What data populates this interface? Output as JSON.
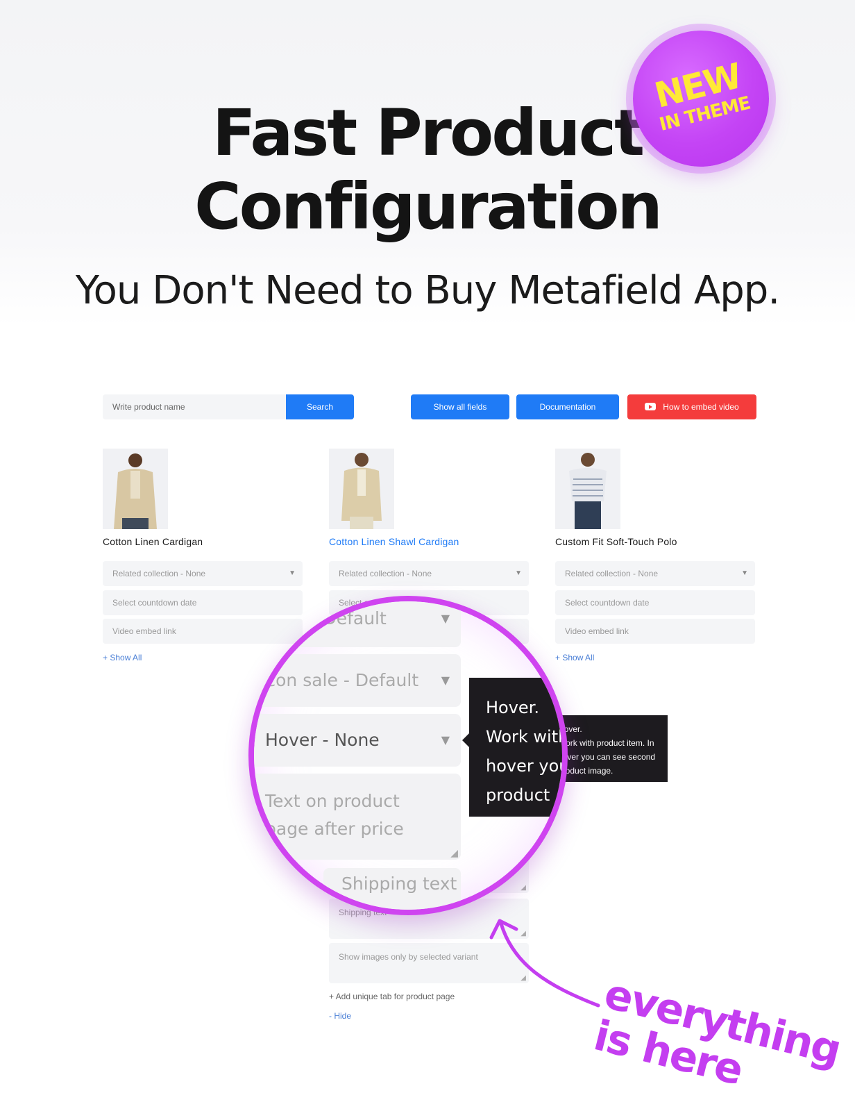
{
  "hero": {
    "title_line1": "Fast Product",
    "title_line2": "Configuration",
    "subtitle": "You Don't Need to Buy Metafield App.",
    "badge_new": "NEW",
    "badge_sub": "IN THEME"
  },
  "toolbar": {
    "search_placeholder": "Write product name",
    "search_label": "Search",
    "show_all_fields_label": "Show all fields",
    "documentation_label": "Documentation",
    "embed_video_label": "How to embed video"
  },
  "products": [
    {
      "name": "Cotton Linen Cardigan",
      "related_collection": "Related collection - None",
      "countdown_placeholder": "Select countdown date",
      "video_placeholder": "Video embed link",
      "show_all_label": "+ Show All"
    },
    {
      "name": "Cotton Linen Shawl Cardigan",
      "related_collection": "Related collection - None",
      "countdown_placeholder": "Select countdown date",
      "shipping_placeholder": "Shipping text",
      "variant_images_placeholder": "Show images only by selected variant",
      "add_tab_label": "+ Add unique tab for product page",
      "hide_label": "- Hide"
    },
    {
      "name": "Custom Fit Soft-Touch Polo",
      "related_collection": "Related collection - None",
      "countdown_placeholder": "Select countdown date",
      "video_placeholder": "Video embed link",
      "show_all_label": "+ Show All"
    }
  ],
  "tooltip": {
    "line1": "Hover.",
    "line2": "Work with product item. In",
    "line3": "hover you can see second",
    "line4": "product image."
  },
  "magnifier": {
    "field_new": "New - Default",
    "field_icon_sale": "Icon sale - Default",
    "field_hover": "Hover - None",
    "field_text_line1": "Text on product",
    "field_text_line2": "page after price",
    "field_shipping": "Shipping text",
    "tip_line1": "Hover.",
    "tip_line2": "Work with",
    "tip_line3": "hover you",
    "tip_line4": "product"
  },
  "annotation": {
    "line1": "everything",
    "line2": "is here"
  },
  "colors": {
    "accent_blue": "#1f7bf6",
    "accent_red": "#f43c3c",
    "accent_purple": "#cf44f0",
    "badge_yellow": "#ffe936"
  }
}
